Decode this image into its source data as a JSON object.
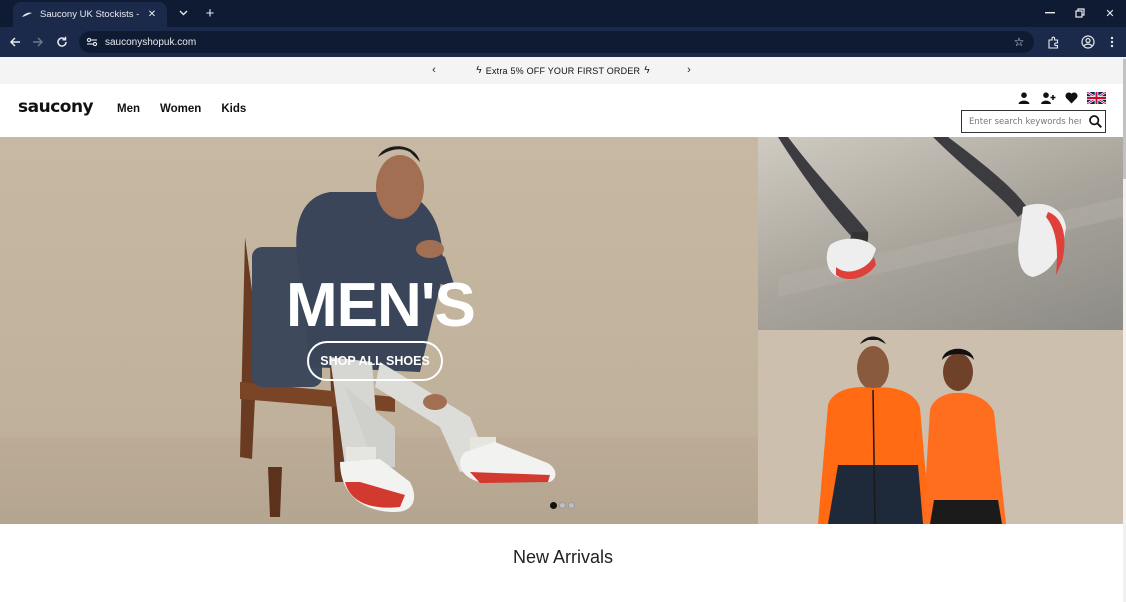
{
  "browser": {
    "tab_title": "Saucony UK Stockists - Saucony",
    "url": "sauconyshopuk.com"
  },
  "promo": {
    "text": "Extra 5% OFF YOUR FIRST ORDER"
  },
  "header": {
    "logo": "saucony",
    "nav": [
      "Men",
      "Women",
      "Kids"
    ],
    "search_placeholder": "Enter search keywords here"
  },
  "hero": {
    "headline": "MEN'S",
    "cta": "SHOP ALL SHOES",
    "slides_total": 3,
    "active_slide": 1
  },
  "section": {
    "title": "New Arrivals"
  },
  "colors": {
    "chrome_dark": "#0f1b33",
    "chrome_toolbar": "#1b2a4a",
    "orange": "#ff6a13"
  }
}
